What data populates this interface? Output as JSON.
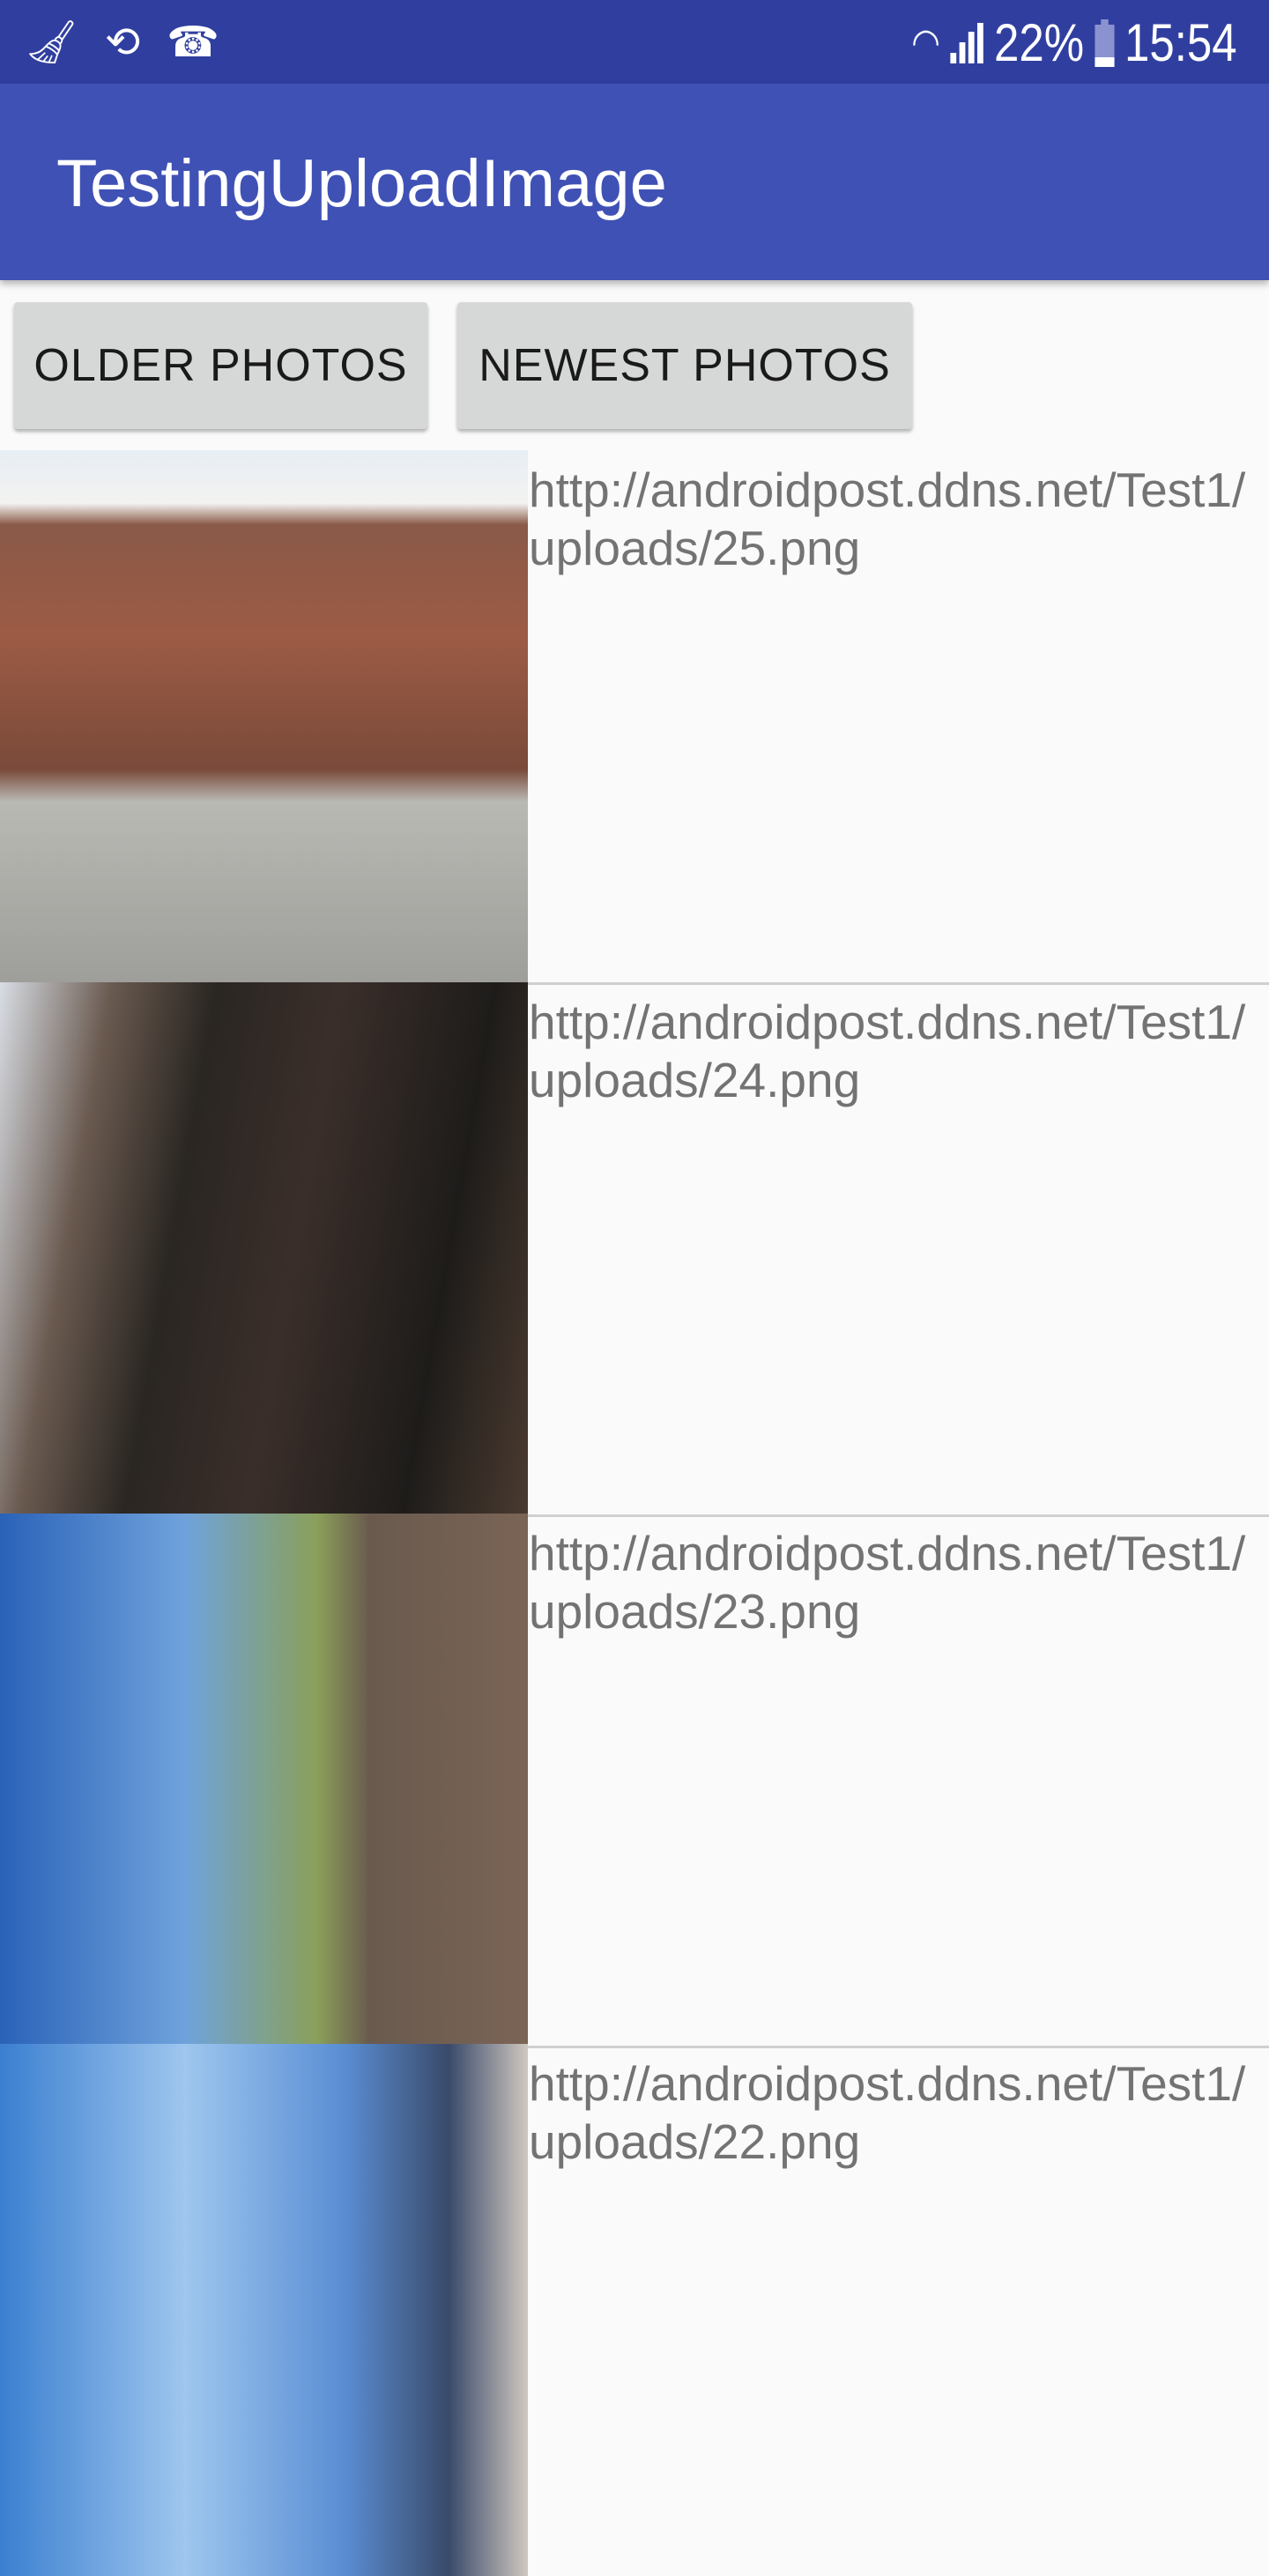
{
  "status_bar": {
    "left_icons": [
      "broom-icon",
      "sync-icon",
      "missed-call-icon"
    ],
    "battery": "22%",
    "battery_level": 0.22,
    "time": "15:54",
    "right_icons": [
      "wifi-icon",
      "signal-icon",
      "battery-icon"
    ]
  },
  "app_bar": {
    "title": "TestingUploadImage"
  },
  "buttons": {
    "older": "OLDER PHOTOS",
    "newest": "NEWEST PHOTOS"
  },
  "photos": [
    {
      "url": "http://androidpost.ddns.net/Test1/uploads/25.png"
    },
    {
      "url": "http://androidpost.ddns.net/Test1/uploads/24.png"
    },
    {
      "url": "http://androidpost.ddns.net/Test1/uploads/23.png"
    },
    {
      "url": "http://androidpost.ddns.net/Test1/uploads/22.png"
    }
  ],
  "colors": {
    "status_bar": "#303f9f",
    "app_bar": "#3f51b5",
    "button": "#d6d7d7"
  }
}
